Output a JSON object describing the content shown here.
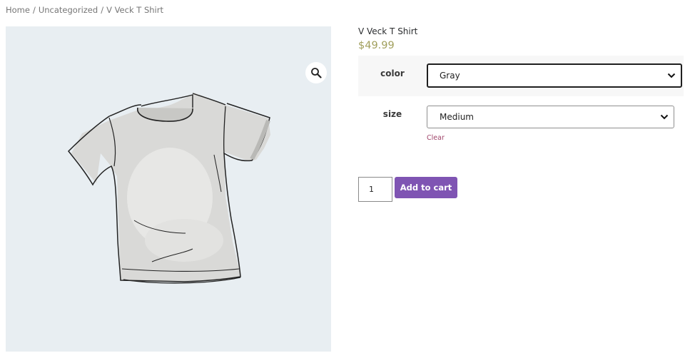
{
  "breadcrumb": {
    "home": "Home",
    "separator": "/",
    "category": "Uncategorized",
    "current": "V Veck T Shirt"
  },
  "gallery": {
    "zoom_icon": "magnifier-icon",
    "image": "t-shirt-illustration"
  },
  "product": {
    "title": "V Veck T Shirt",
    "price": "$49.99"
  },
  "variations": {
    "color": {
      "label": "color",
      "selected": "Gray"
    },
    "size": {
      "label": "size",
      "selected": "Medium"
    },
    "clear_label": "Clear"
  },
  "cart": {
    "quantity": "1",
    "add_label": "Add to cart"
  },
  "colors": {
    "accent": "#7f54b3",
    "price": "#a19f5c",
    "clear_link": "#a0456a",
    "gallery_bg": "#e8eef2"
  }
}
